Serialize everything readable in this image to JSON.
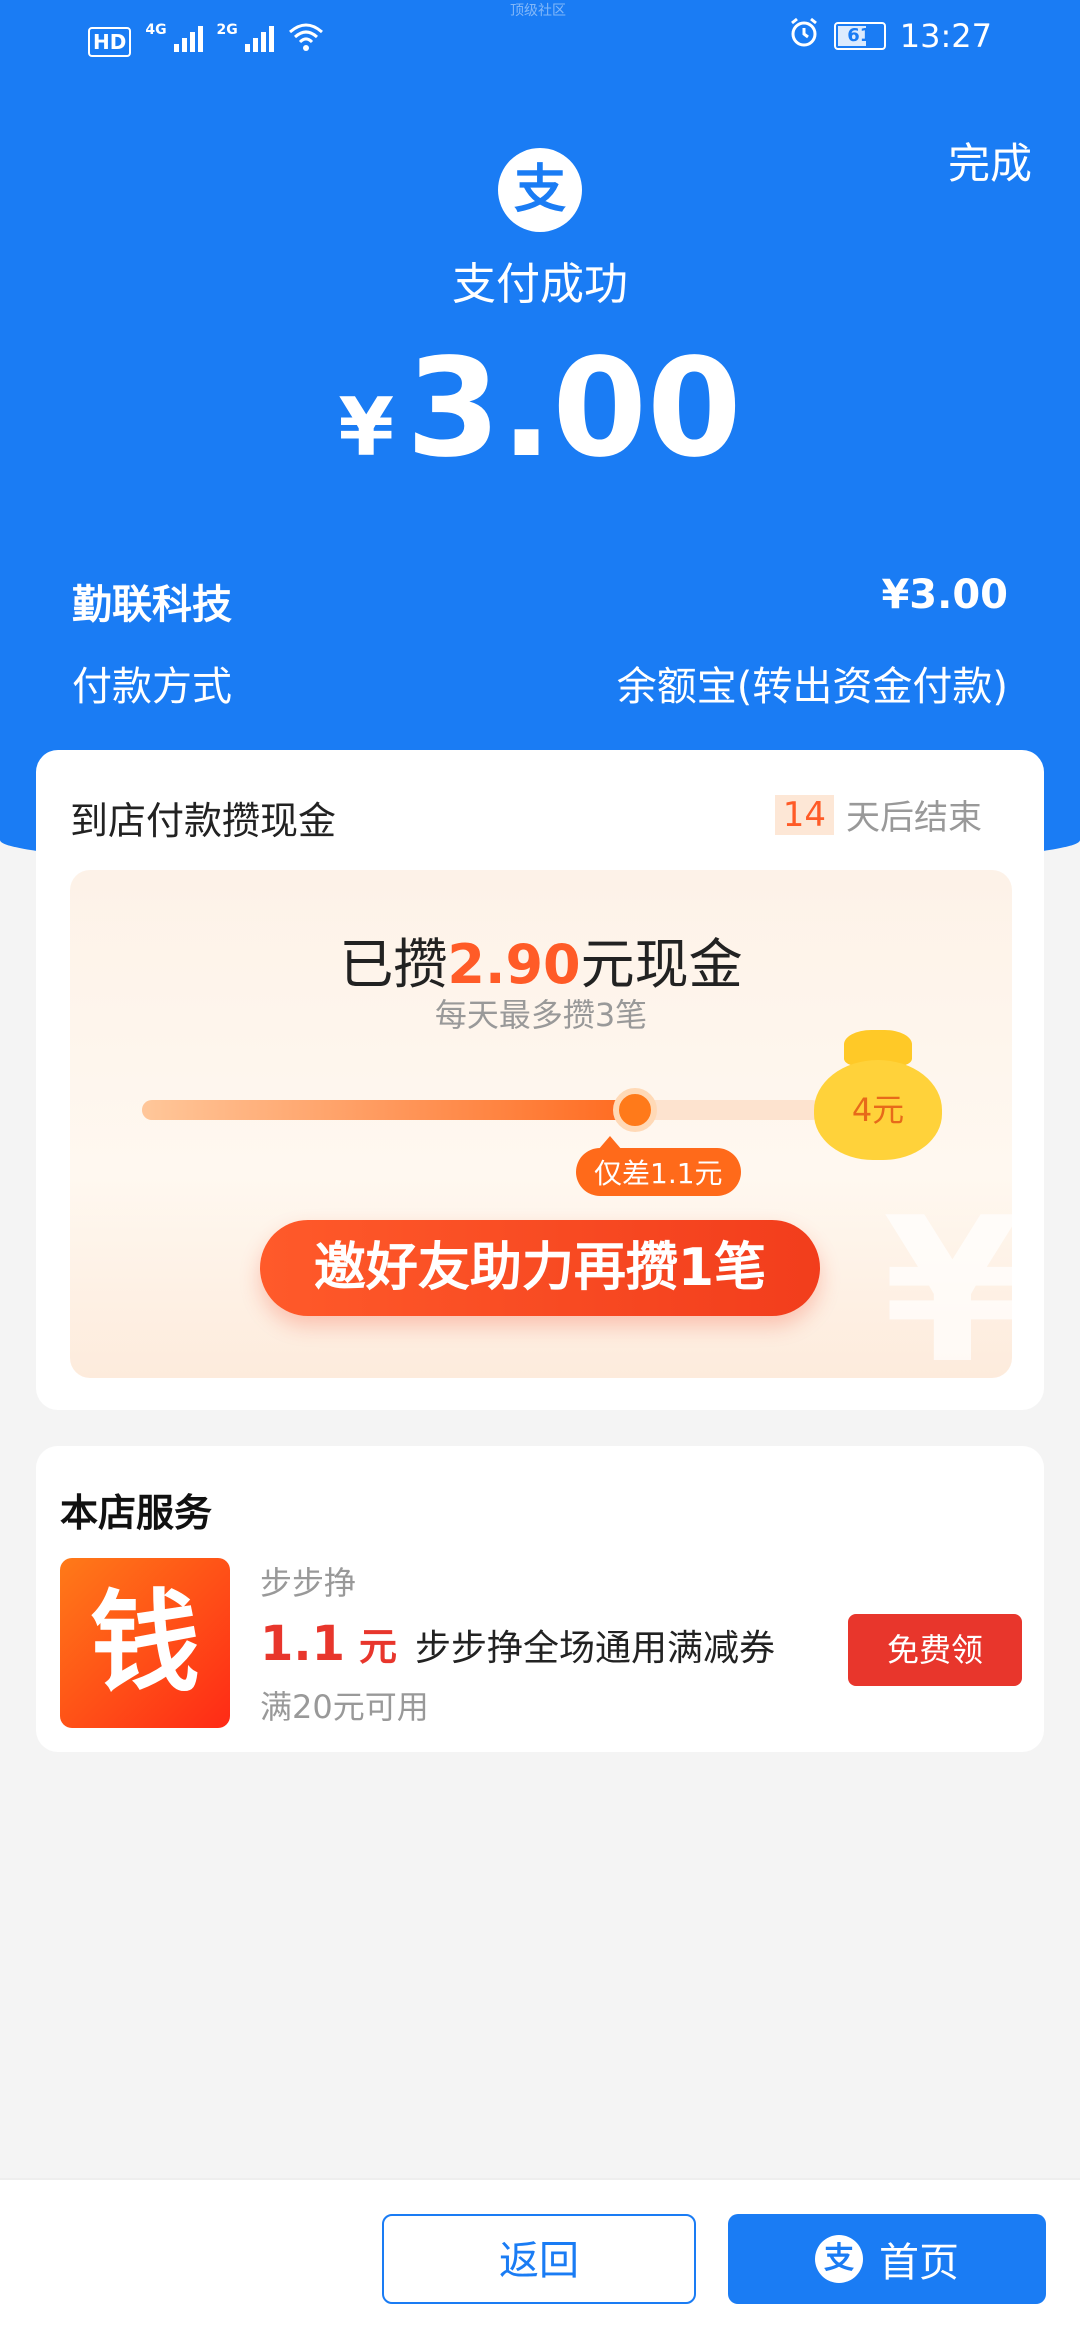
{
  "status_bar": {
    "time": "13:27",
    "battery": "61",
    "network_1": "4G",
    "network_2": "2G",
    "hd": "HD",
    "watermark": "顶级社区",
    "icons": [
      "hd-icon",
      "signal-icon",
      "signal-icon",
      "wifi-icon",
      "alarm-icon",
      "battery-icon"
    ]
  },
  "header": {
    "done_label": "完成",
    "logo_glyph": "支",
    "title": "支付成功",
    "currency": "¥",
    "amount": "3.00"
  },
  "details": {
    "merchant_label": "勤联科技",
    "merchant_amount": "¥3.00",
    "method_label": "付款方式",
    "method_value": "余额宝(转出资金付款)"
  },
  "cashback": {
    "title": "到店付款攒现金",
    "days_left": "14",
    "days_suffix": "天后结束",
    "saved_prefix": "已攒",
    "saved_amount": "2.90",
    "saved_suffix": "元现金",
    "daily_limit": "每天最多攒3笔",
    "progress_fraction": 0.725,
    "goal_label": "4元",
    "gap_tip": "仅差1.1元",
    "invite_label": "邀好友助力再攒1笔",
    "watermark_glyph": "¥"
  },
  "services": {
    "title": "本店服务",
    "shop_glyph": "钱",
    "coupon_source": "步步挣",
    "coupon_amount": "1.1",
    "coupon_unit": "元",
    "coupon_name": "步步挣全场通用满减券",
    "coupon_condition": "满20元可用",
    "claim_label": "免费领"
  },
  "bottom": {
    "back_label": "返回",
    "home_label": "首页",
    "home_logo": "支"
  },
  "colors": {
    "brand_blue": "#1a7cf4",
    "accent_orange": "#ff5b27",
    "coupon_red": "#e8362c"
  }
}
